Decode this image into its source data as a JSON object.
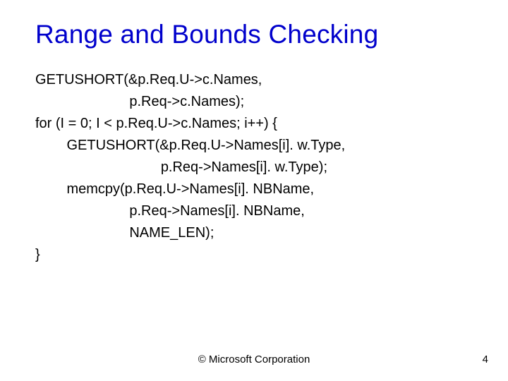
{
  "title": "Range and Bounds Checking",
  "code": {
    "l0": "GETUSHORT(&p.Req.U->c.Names,",
    "l1": "                        p.Req->c.Names);",
    "l2": "for (I = 0; I < p.Req.U->c.Names; i++) {",
    "l3": "        GETUSHORT(&p.Req.U->Names[i]. w.Type,",
    "l4": "                                p.Req->Names[i]. w.Type);",
    "l5": "        memcpy(p.Req.U->Names[i]. NBName,",
    "l6": "                        p.Req->Names[i]. NBName,",
    "l7": "                        NAME_LEN);",
    "l8": "}"
  },
  "footer": {
    "copyright": "© Microsoft Corporation",
    "page_number": "4"
  }
}
